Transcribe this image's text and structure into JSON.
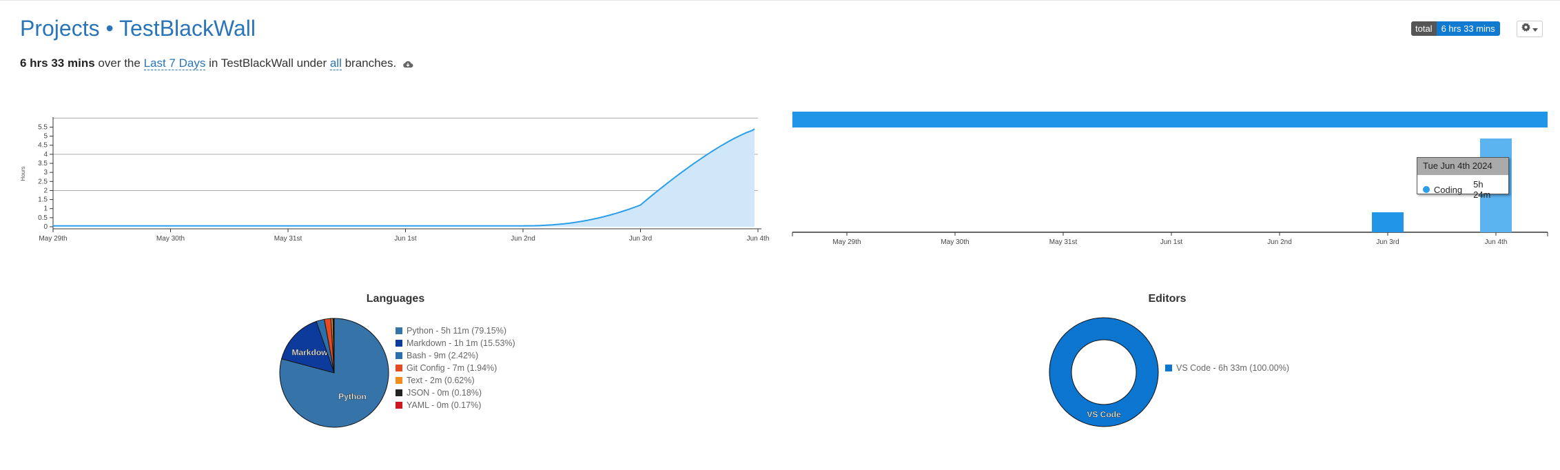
{
  "header": {
    "title_projects": "Projects",
    "title_sep": "•",
    "title_project": "TestBlackWall",
    "total_key": "total",
    "total_value": "6 hrs 33 mins"
  },
  "summary": {
    "duration": "6 hrs 33 mins",
    "t1": "over the",
    "range_link": "Last 7 Days",
    "t2": "in TestBlackWall under",
    "branch_link": "all",
    "t3": "branches."
  },
  "icons": {
    "cloud": "cloud-icon",
    "gear": "gear-icon",
    "caret": "caret-down-icon"
  },
  "colors": {
    "accent": "#2a74b8",
    "area_line": "#2a9ee8",
    "area_fill": "#cfe7f9",
    "bar": "#2196e8",
    "bar_hover": "#5bb3f0"
  },
  "tooltip": {
    "date": "Tue Jun 4th 2024",
    "label": "Coding",
    "value": "5h 24m"
  },
  "sections": {
    "languages_title": "Languages",
    "editors_title": "Editors"
  },
  "chart_data": [
    {
      "type": "area",
      "ylabel": "Hours",
      "x": [
        "May 29th",
        "May 30th",
        "May 31st",
        "Jun 1st",
        "Jun 2nd",
        "Jun 3rd",
        "Jun 4th"
      ],
      "yticks": [
        "0",
        "0.5",
        "1",
        "1.5",
        "2",
        "2.5",
        "3",
        "3.5",
        "4",
        "4.5",
        "5",
        "5.5"
      ],
      "values": [
        0,
        0,
        0,
        0,
        0,
        1.2,
        5.4
      ],
      "ylim": [
        0,
        6
      ],
      "grid": true
    },
    {
      "type": "bar",
      "x": [
        "May 29th",
        "May 30th",
        "May 31st",
        "Jun 1st",
        "Jun 2nd",
        "Jun 3rd",
        "Jun 4th"
      ],
      "series": [
        {
          "name": "Coding",
          "values": [
            0,
            0,
            0,
            0,
            0,
            1.15,
            5.4
          ]
        }
      ],
      "timeline_bar": true
    },
    {
      "type": "pie",
      "title": "Languages",
      "slices": [
        {
          "label": "Python",
          "legend": "Python - 5h 11m (79.15%)",
          "value": 79.15,
          "color": "#3673a9",
          "show_label": true
        },
        {
          "label": "Markdown",
          "legend": "Markdown - 1h 1m (15.53%)",
          "value": 15.53,
          "color": "#0c3b9c",
          "show_label": true,
          "short": "Markdown"
        },
        {
          "label": "Bash",
          "legend": "Bash - 9m (2.42%)",
          "value": 2.42,
          "color": "#2d6fab"
        },
        {
          "label": "Git Config",
          "legend": "Git Config - 7m (1.94%)",
          "value": 1.94,
          "color": "#e44b23"
        },
        {
          "label": "Text",
          "legend": "Text - 2m (0.62%)",
          "value": 0.62,
          "color": "#f28c1e"
        },
        {
          "label": "JSON",
          "legend": "JSON - 0m (0.18%)",
          "value": 0.18,
          "color": "#222222"
        },
        {
          "label": "YAML",
          "legend": "YAML - 0m (0.17%)",
          "value": 0.17,
          "color": "#cb171e"
        }
      ]
    },
    {
      "type": "pie",
      "title": "Editors",
      "slices": [
        {
          "label": "VS Code",
          "legend": "VS Code - 6h 33m (100.00%)",
          "value": 100.0,
          "color": "#0b75cf",
          "show_label": true
        }
      ]
    }
  ]
}
